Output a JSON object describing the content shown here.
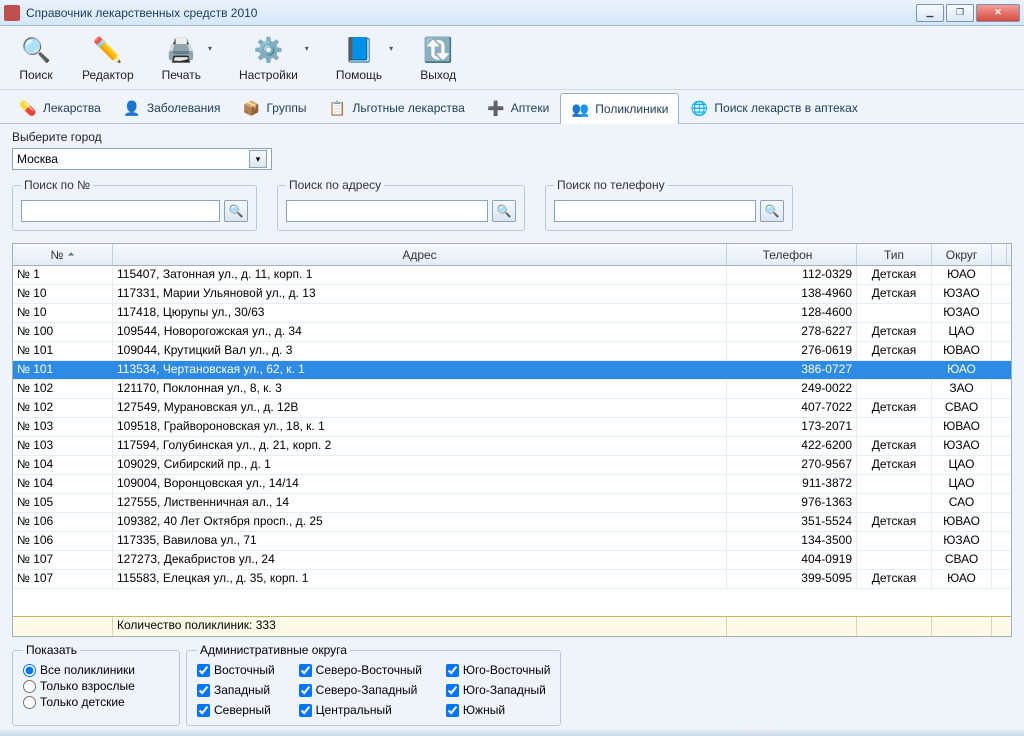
{
  "window": {
    "title": "Справочник лекарственных средств 2010"
  },
  "toolbar": [
    {
      "icon": "search-icon",
      "label": "Поиск"
    },
    {
      "icon": "editor-icon",
      "label": "Редактор"
    },
    {
      "icon": "print-icon",
      "label": "Печать",
      "dropdown": true
    },
    {
      "icon": "settings-icon",
      "label": "Настройки",
      "dropdown": true
    },
    {
      "icon": "help-icon",
      "label": "Помощь",
      "dropdown": true
    },
    {
      "icon": "exit-icon",
      "label": "Выход"
    }
  ],
  "tabs": [
    {
      "icon": "💊",
      "label": "Лекарства"
    },
    {
      "icon": "👤",
      "label": "Заболевания"
    },
    {
      "icon": "📦",
      "label": "Группы"
    },
    {
      "icon": "📋",
      "label": "Льготные лекарства"
    },
    {
      "icon": "➕",
      "label": "Аптеки"
    },
    {
      "icon": "👥",
      "label": "Поликлиники",
      "active": true
    },
    {
      "icon": "🌐",
      "label": "Поиск лекарств в аптеках"
    }
  ],
  "city": {
    "label": "Выберите город",
    "value": "Москва"
  },
  "search": {
    "by_number": "Поиск по №",
    "by_address": "Поиск по адресу",
    "by_phone": "Поиск по телефону"
  },
  "grid": {
    "columns": [
      "№",
      "Адрес",
      "Телефон",
      "Тип",
      "Округ"
    ],
    "rows": [
      {
        "n": "№ 1",
        "addr": "115407, Затонная ул., д. 11, корп. 1",
        "tel": "112-0329",
        "type": "Детская",
        "okr": "ЮАО"
      },
      {
        "n": "№ 10",
        "addr": "117331, Марии Ульяновой ул., д. 13",
        "tel": "138-4960",
        "type": "Детская",
        "okr": "ЮЗАО"
      },
      {
        "n": "№ 10",
        "addr": "117418, Цюрупы ул., 30/63",
        "tel": "128-4600",
        "type": "",
        "okr": "ЮЗАО"
      },
      {
        "n": "№ 100",
        "addr": "109544, Новорогожская ул., д. 34",
        "tel": "278-6227",
        "type": "Детская",
        "okr": "ЦАО"
      },
      {
        "n": "№ 101",
        "addr": "109044, Крутицкий Вал ул., д. 3",
        "tel": "276-0619",
        "type": "Детская",
        "okr": "ЮВАО"
      },
      {
        "n": "№ 101",
        "addr": "113534, Чертановская ул., 62, к. 1",
        "tel": "386-0727",
        "type": "",
        "okr": "ЮАО",
        "sel": true
      },
      {
        "n": "№ 102",
        "addr": "121170, Поклонная ул., 8, к. 3",
        "tel": "249-0022",
        "type": "",
        "okr": "ЗАО"
      },
      {
        "n": "№ 102",
        "addr": "127549, Мурановская ул., д. 12В",
        "tel": "407-7022",
        "type": "Детская",
        "okr": "СВАО"
      },
      {
        "n": "№ 103",
        "addr": "109518, Грайвороновская ул., 18, к. 1",
        "tel": "173-2071",
        "type": "",
        "okr": "ЮВАО"
      },
      {
        "n": "№ 103",
        "addr": "117594, Голубинская ул., д. 21, корп. 2",
        "tel": "422-6200",
        "type": "Детская",
        "okr": "ЮЗАО"
      },
      {
        "n": "№ 104",
        "addr": "109029, Сибирский пр., д. 1",
        "tel": "270-9567",
        "type": "Детская",
        "okr": "ЦАО"
      },
      {
        "n": "№ 104",
        "addr": "109004, Воронцовская ул., 14/14",
        "tel": "911-3872",
        "type": "",
        "okr": "ЦАО"
      },
      {
        "n": "№ 105",
        "addr": "127555, Лиственничная ал., 14",
        "tel": "976-1363",
        "type": "",
        "okr": "САО"
      },
      {
        "n": "№ 106",
        "addr": "109382, 40 Лет Октября просп., д. 25",
        "tel": "351-5524",
        "type": "Детская",
        "okr": "ЮВАО"
      },
      {
        "n": "№ 106",
        "addr": "117335, Вавилова ул., 71",
        "tel": "134-3500",
        "type": "",
        "okr": "ЮЗАО"
      },
      {
        "n": "№ 107",
        "addr": "127273, Декабристов ул., 24",
        "tel": "404-0919",
        "type": "",
        "okr": "СВАО"
      },
      {
        "n": "№ 107",
        "addr": "115583, Елецкая ул., д. 35, корп. 1",
        "tel": "399-5095",
        "type": "Детская",
        "okr": "ЮАО"
      }
    ],
    "footer": "Количество поликлиник: 333"
  },
  "filters": {
    "show_label": "Показать",
    "all": "Все поликлиники",
    "adult": "Только взрослые",
    "child": "Только детские",
    "districts_label": "Административные округа",
    "districts": [
      [
        "Восточный",
        "Северо-Восточный",
        "Юго-Восточный"
      ],
      [
        "Западный",
        "Северо-Западный",
        "Юго-Западный"
      ],
      [
        "Северный",
        "Центральный",
        "Южный"
      ]
    ]
  }
}
